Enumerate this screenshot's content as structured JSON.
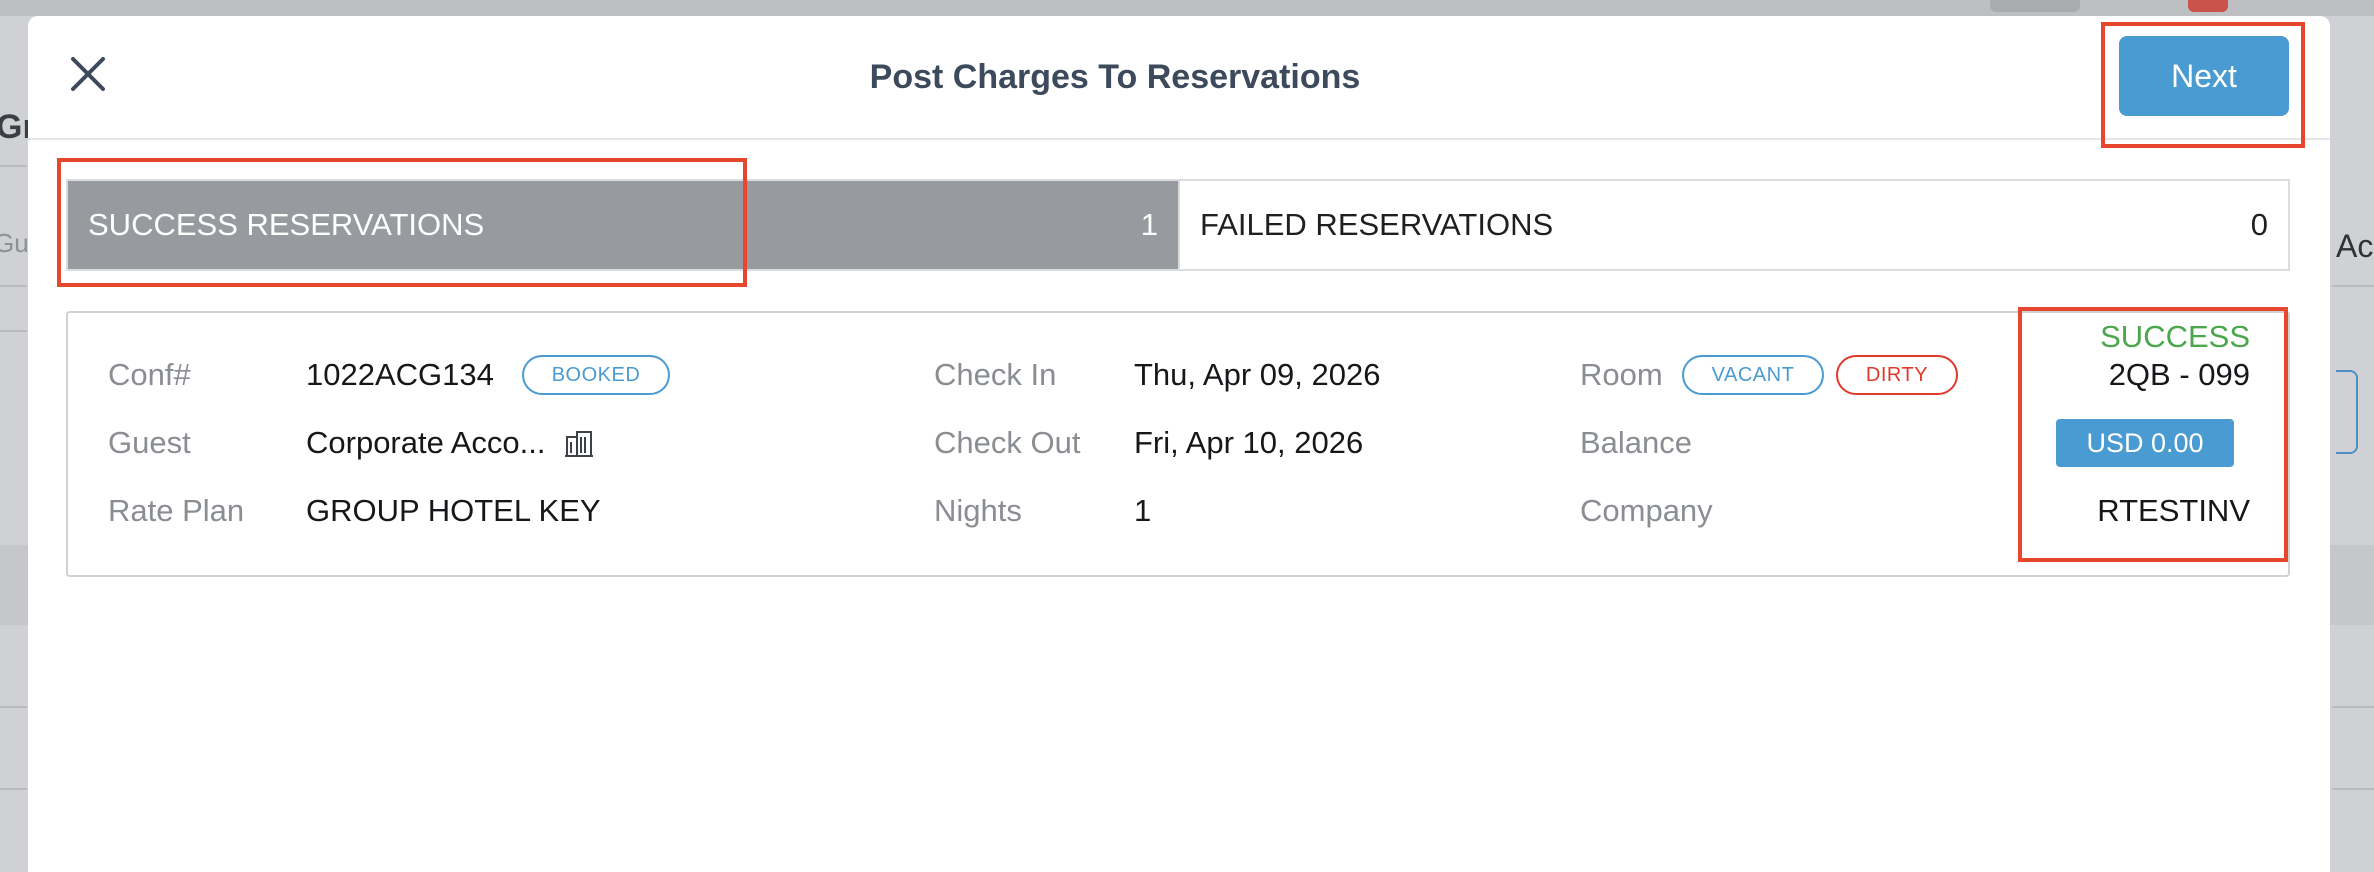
{
  "modal": {
    "title": "Post Charges To Reservations",
    "next_label": "Next",
    "close_icon": "close-icon"
  },
  "tabs": [
    {
      "label": "SUCCESS RESERVATIONS",
      "count": "1",
      "active": true
    },
    {
      "label": "FAILED RESERVATIONS",
      "count": "0",
      "active": false
    }
  ],
  "reservation": {
    "conf_label": "Conf#",
    "conf_value": "1022ACG134",
    "conf_badge": "BOOKED",
    "guest_label": "Guest",
    "guest_value": "Corporate Acco...",
    "guest_icon": "company-icon",
    "rate_plan_label": "Rate Plan",
    "rate_plan_value": "GROUP HOTEL KEY",
    "check_in_label": "Check In",
    "check_in_value": "Thu, Apr 09, 2026",
    "check_out_label": "Check Out",
    "check_out_value": "Fri, Apr 10, 2026",
    "nights_label": "Nights",
    "nights_value": "1",
    "room_label": "Room",
    "room_badges": [
      "VACANT",
      "DIRTY"
    ],
    "balance_label": "Balance",
    "company_label": "Company",
    "status": "SUCCESS",
    "room_number": "2QB - 099",
    "balance_value": "USD 0.00",
    "company_value": "RTESTINV"
  },
  "background": {
    "left_heading": "Gr",
    "left_field": "Gue",
    "right_text": "Ac"
  },
  "colors": {
    "accent": "#4a9bd1",
    "success": "#4ca64c",
    "danger": "#e03a2b",
    "highlight": "#e8472f",
    "active_tab": "#979a9f"
  }
}
